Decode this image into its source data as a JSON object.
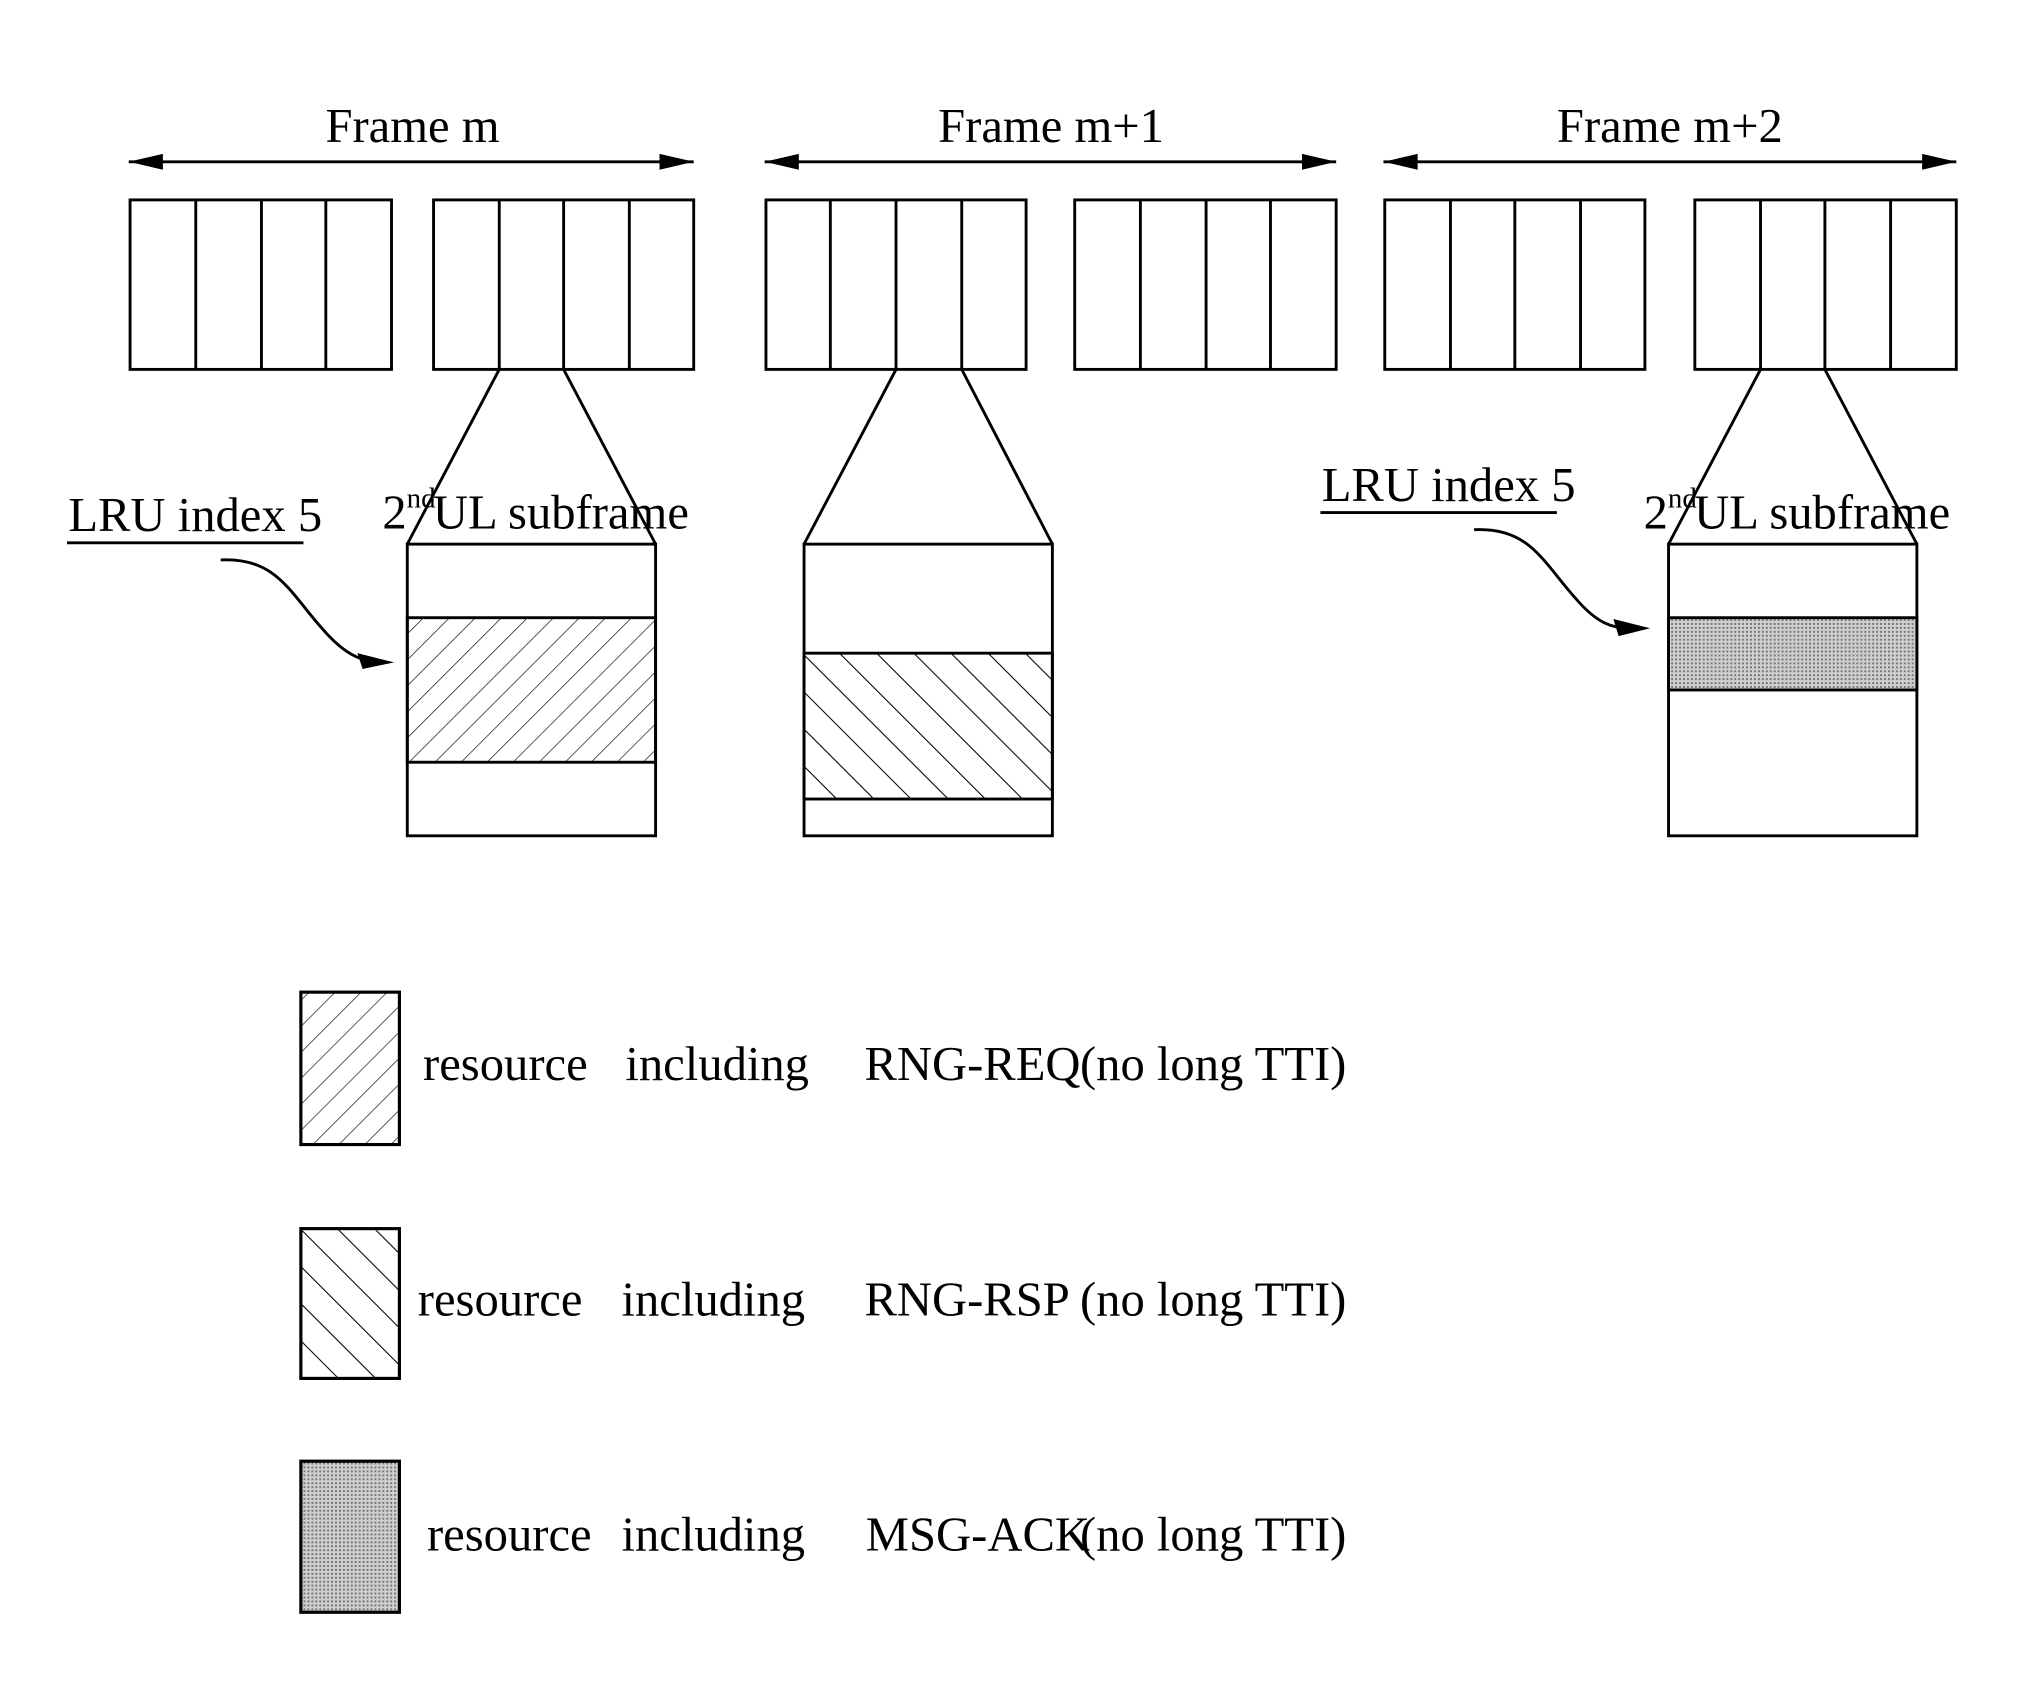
{
  "frames": [
    {
      "label": "Frame m"
    },
    {
      "label": "Frame m+1"
    },
    {
      "label": "Frame m+2"
    }
  ],
  "annotations": {
    "lru_left": "LRU index 5",
    "lru_right": "LRU index 5",
    "ul_subframe_left": {
      "ordinal": "2",
      "suffix": "nd",
      "text": "UL subframe"
    },
    "ul_subframe_right": {
      "ordinal": "2",
      "suffix": "nd",
      "text": "UL subframe"
    }
  },
  "legend": [
    {
      "pattern": "sparse-forward-hatch",
      "word1": "resource",
      "word2": "including",
      "message": "RNG-REQ",
      "note": "(no long TTI)"
    },
    {
      "pattern": "backward-hatch",
      "word1": "resource",
      "word2": "including",
      "message": "RNG-RSP",
      "note": "(no long TTI)"
    },
    {
      "pattern": "dotted-gray",
      "word1": "resource",
      "word2": "including",
      "message": "MSG-ACK",
      "note": "(no long TTI)"
    }
  ],
  "colors": {
    "line": "#000000",
    "dotted_fill": "#b8b8b8",
    "background": "#ffffff"
  }
}
